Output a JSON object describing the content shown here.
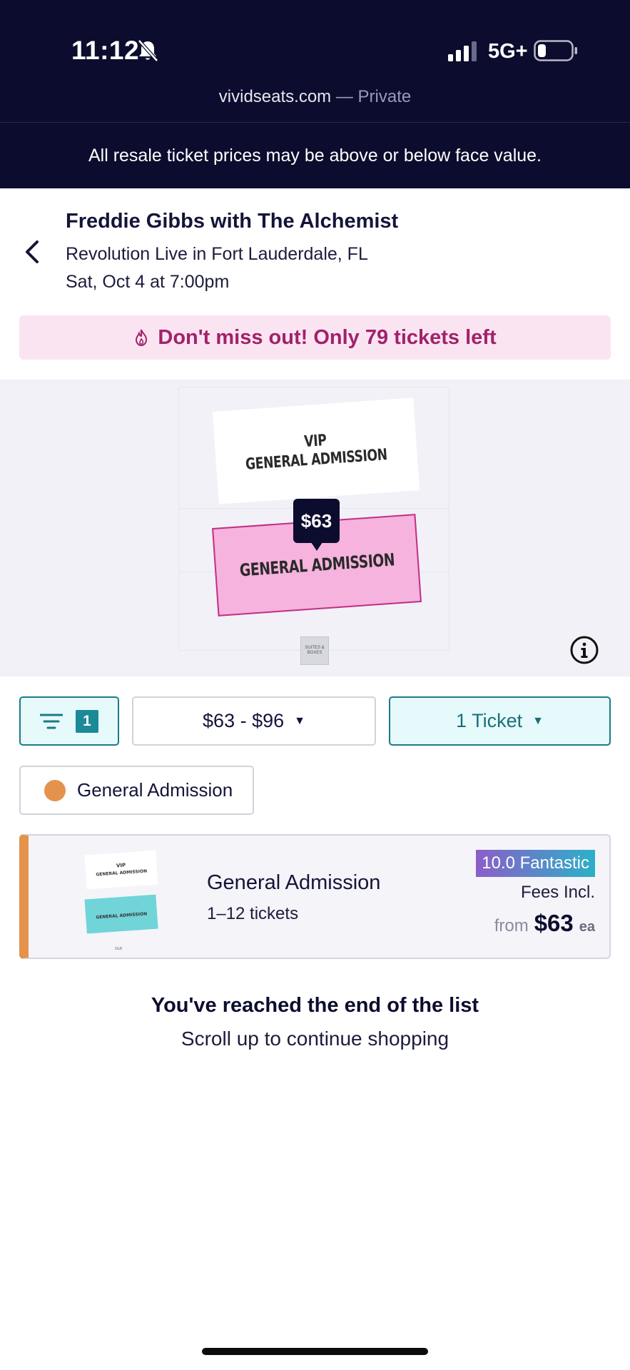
{
  "status_bar": {
    "time": "11:12",
    "network": "5G+",
    "icons": [
      "bell-slash-icon",
      "signal-icon",
      "battery-icon"
    ]
  },
  "browser": {
    "domain": "vividseats.com",
    "mode": " — Private"
  },
  "disclaimer": "All resale ticket prices may be above or below face value.",
  "event": {
    "title": "Freddie Gibbs with The Alchemist",
    "venue": "Revolution Live in Fort Lauderdale, FL",
    "date": "Sat, Oct 4 at 7:00pm"
  },
  "urgency": {
    "text": "Don't miss out! Only 79 tickets left",
    "color": "#a0226b",
    "background": "#fbe4f1"
  },
  "map": {
    "sections": [
      {
        "line1": "VIP",
        "line2": "GENERAL ADMISSION"
      },
      {
        "label": "GENERAL ADMISSION",
        "color": "#f5b3dd"
      }
    ],
    "price_pin": "$63",
    "suites_label": "SUITES & BOXES"
  },
  "filters": {
    "filter_count": "1",
    "price_range": "$63 - $96",
    "quantity": "1 Ticket",
    "chip_label": "General Admission",
    "chip_color": "#e3934c"
  },
  "listing": {
    "thumb_vip_line1": "VIP",
    "thumb_vip_line2": "GENERAL ADMISSION",
    "thumb_ga": "GENERAL ADMISSION",
    "thumb_suites": "S&B",
    "title": "General Admission",
    "tickets": "1–12 tickets",
    "rating": "10.0 Fantastic",
    "fees": "Fees Incl.",
    "from": "from",
    "price": "$63",
    "unit": "ea"
  },
  "end_of_list": {
    "title": "You've reached the end of the list",
    "subtitle": "Scroll up to continue shopping"
  },
  "colors": {
    "brand_navy": "#0c0c2e",
    "teal": "#1b7b86",
    "ga_pink": "#f5b3dd",
    "orange": "#e3934c"
  }
}
